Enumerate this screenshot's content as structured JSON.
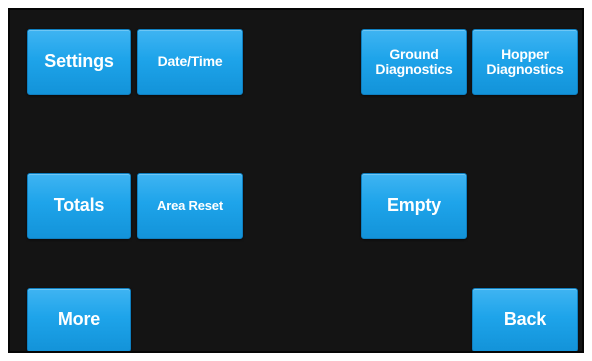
{
  "buttons": {
    "settings": "Settings",
    "date_time": "Date/Time",
    "ground_diagnostics_line1": "Ground",
    "ground_diagnostics_line2": "Diagnostics",
    "hopper_diagnostics_line1": "Hopper",
    "hopper_diagnostics_line2": "Diagnostics",
    "totals": "Totals",
    "area_reset": "Area Reset",
    "empty": "Empty",
    "more": "More",
    "back": "Back"
  },
  "colors": {
    "button": "#1ea4ea",
    "screen_background": "#141414",
    "text": "#ffffff"
  }
}
